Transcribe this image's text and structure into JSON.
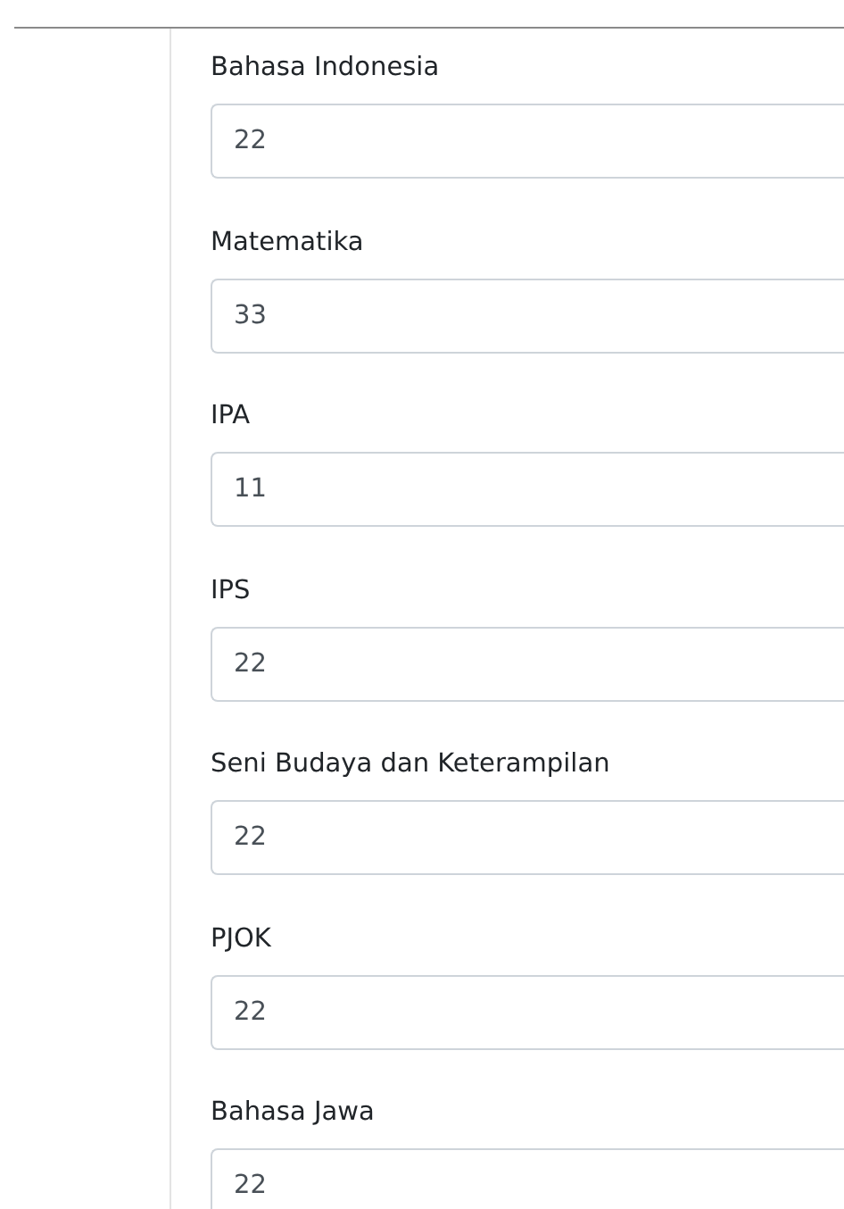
{
  "fields": [
    {
      "label": "Bahasa Indonesia",
      "value": "22"
    },
    {
      "label": "Matematika",
      "value": "33"
    },
    {
      "label": "IPA",
      "value": "11"
    },
    {
      "label": "IPS",
      "value": "22"
    },
    {
      "label": "Seni Budaya dan Keterampilan",
      "value": "22"
    },
    {
      "label": "PJOK",
      "value": "22"
    },
    {
      "label": "Bahasa Jawa",
      "value": "22"
    }
  ]
}
